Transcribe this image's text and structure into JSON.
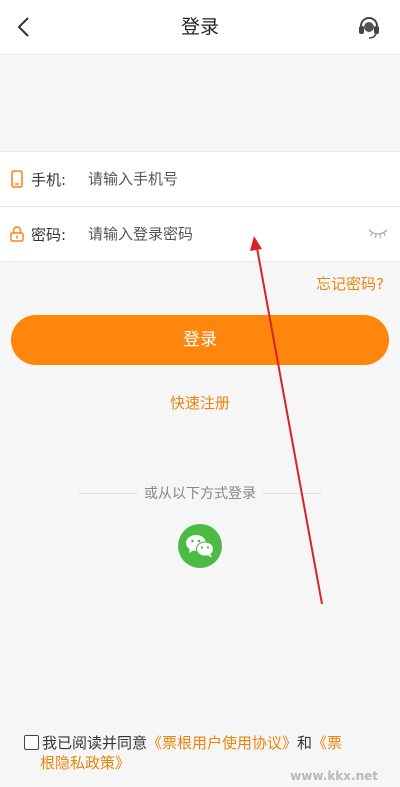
{
  "header": {
    "title": "登录"
  },
  "form": {
    "phone_label": "手机:",
    "phone_placeholder": "请输入手机号",
    "password_label": "密码:",
    "password_placeholder": "请输入登录密码"
  },
  "forgot_password": "忘记密码?",
  "login_button": "登录",
  "register_link": "快速注册",
  "alt_login_text": "或从以下方式登录",
  "agreement": {
    "prefix": "我已阅读并同意",
    "user_agreement": "《票根用户使用协议》",
    "and": "和",
    "privacy_policy_part1": "《票",
    "privacy_policy_part2": "根隐私政策》"
  },
  "watermark": "www.kkx.net",
  "colors": {
    "accent": "#fe860c",
    "link": "#e8860c",
    "wechat": "#4cbb43",
    "annotation": "#d62424"
  },
  "icons": [
    "back-arrow-icon",
    "headset-icon",
    "phone-icon",
    "lock-icon",
    "eye-closed-icon",
    "wechat-icon"
  ]
}
